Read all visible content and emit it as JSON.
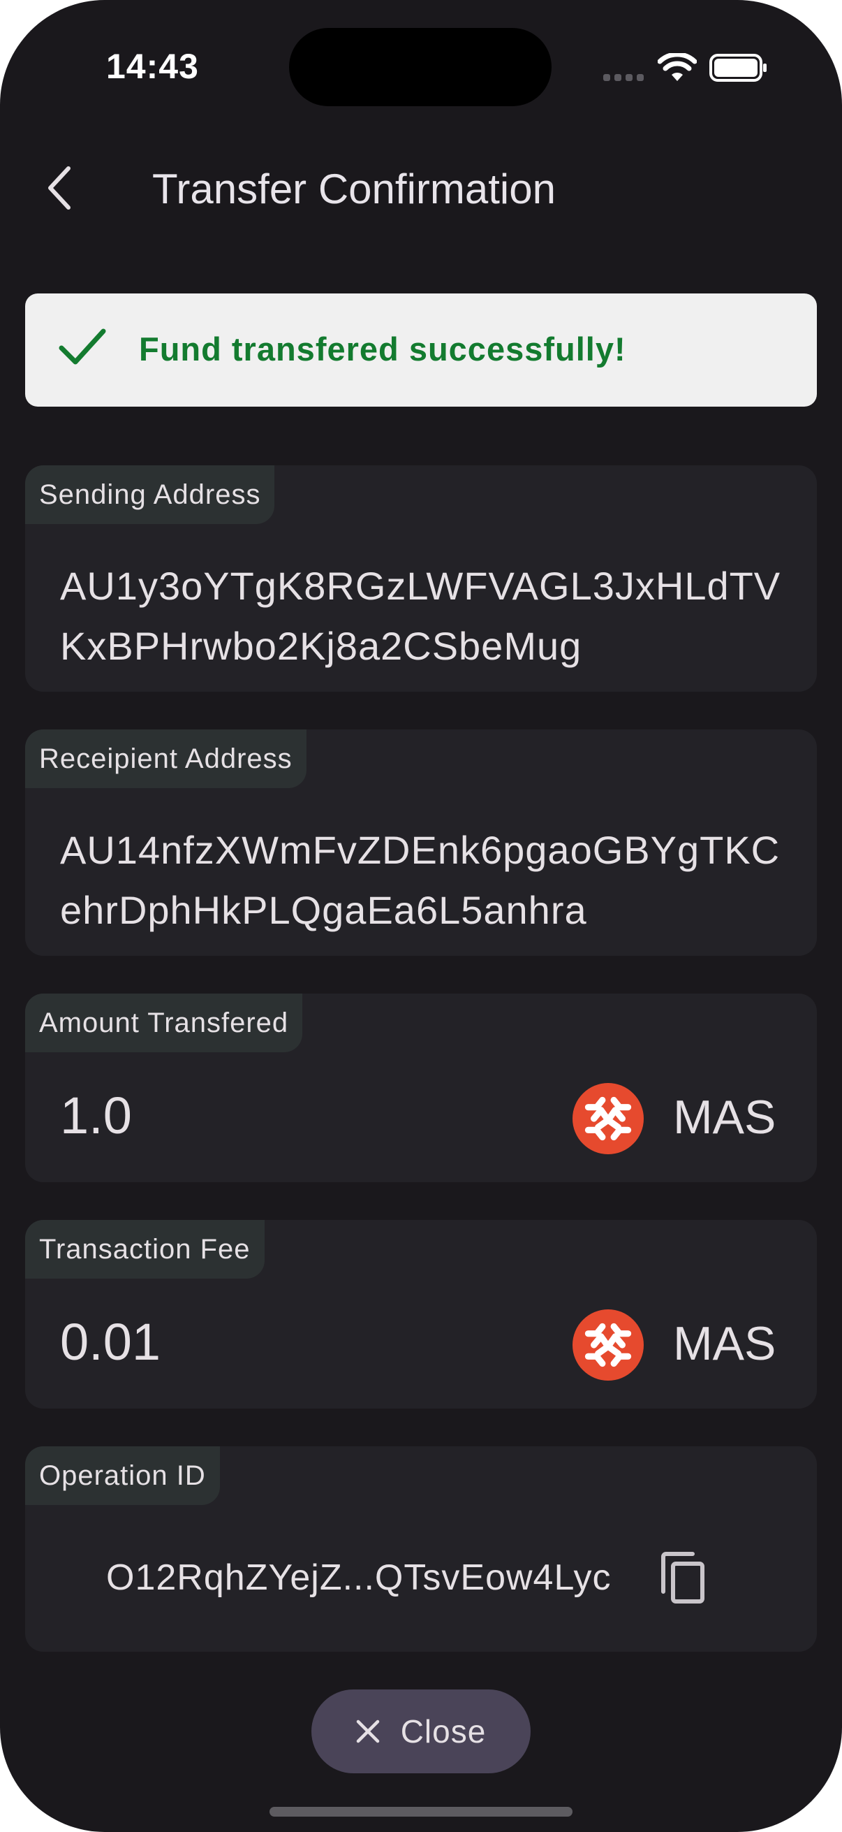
{
  "status_bar": {
    "time": "14:43"
  },
  "header": {
    "title": "Transfer Confirmation"
  },
  "banner": {
    "message": "Fund transfered successfully!",
    "color": "#137b2f"
  },
  "sending": {
    "label": "Sending Address",
    "value": "AU1y3oYTgK8RGzLWFVAGL3JxHLdTVKxBPHrwbo2Kj8a2CSbeMug"
  },
  "recipient": {
    "label": "Receipient Address",
    "value": "AU14nfzXWmFvZDEnk6pgaoGBYgTKCehrDphHkPLQgaEa6L5anhra"
  },
  "amount": {
    "label": "Amount Transfered",
    "value": "1.0",
    "token": "MAS"
  },
  "fee": {
    "label": "Transaction Fee",
    "value": "0.01",
    "token": "MAS"
  },
  "operation": {
    "label": "Operation ID",
    "value": "O12RqhZYejZ...QTsvEow4Lyc"
  },
  "footer": {
    "close_label": "Close"
  },
  "colors": {
    "background": "#1a181c",
    "card": "#232227",
    "token_brand": "#e64a2e"
  }
}
